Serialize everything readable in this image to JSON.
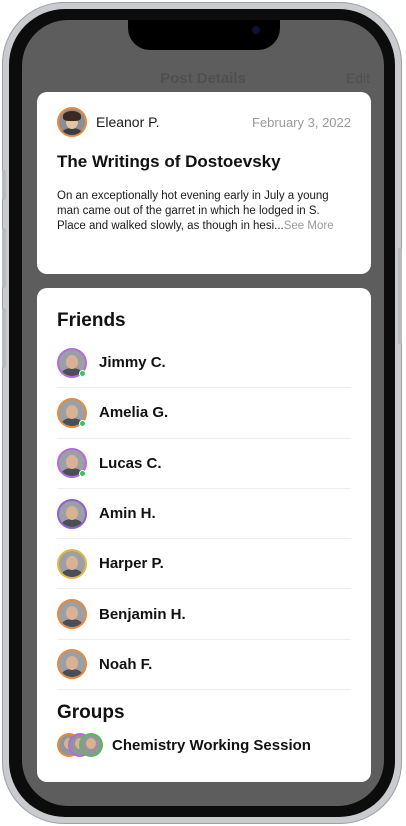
{
  "background": {
    "nav_title": "Post Details",
    "nav_edit": "Edit"
  },
  "post": {
    "author": "Eleanor P.",
    "date": "February 3, 2022",
    "title": "The Writings of Dostoevsky",
    "body": "On an exceptionally hot evening early in July a young man came out of the garret in which he lodged in S. Place and walked slowly, as though in hesi...",
    "see_more": "See More",
    "avatar_ring": "#e88a3c"
  },
  "friends": {
    "title": "Friends",
    "items": [
      {
        "name": "Jimmy C.",
        "ring": "#b46bd6",
        "online": true
      },
      {
        "name": "Amelia G.",
        "ring": "#e88a3c",
        "online": true
      },
      {
        "name": "Lucas C.",
        "ring": "#b46bd6",
        "online": true
      },
      {
        "name": "Amin H.",
        "ring": "#8e5fd0",
        "online": false
      },
      {
        "name": "Harper P.",
        "ring": "#e7b93a",
        "online": false
      },
      {
        "name": "Benjamin H.",
        "ring": "#e88a3c",
        "online": false
      },
      {
        "name": "Noah F.",
        "ring": "#e88a3c",
        "online": false
      }
    ]
  },
  "groups": {
    "title": "Groups",
    "items": [
      {
        "name": "Chemistry Working Session"
      }
    ]
  },
  "colors": {
    "online": "#34c759",
    "muted_text": "#9a9a9a",
    "card": "#ffffff",
    "screen_dim": "#5d5d5d"
  }
}
